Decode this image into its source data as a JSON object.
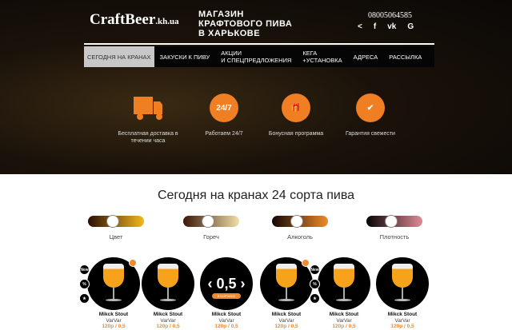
{
  "header": {
    "logo_main": "CraftBeer",
    "logo_suffix": ".kh.ua",
    "tagline": "МАГАЗИН КРАФТОВОГО ПИВА В ХАРЬКОВЕ",
    "phone": "08005064585",
    "social": [
      "<",
      "f",
      "vk",
      "G"
    ]
  },
  "nav": [
    "СЕГОДНЯ НА КРАНАХ",
    "ЗАКУСКИ К ПИВУ",
    "АКЦИИ\nИ СПЕЦПРЕДЛОЖЕНИЯ",
    "КЕГА\n+УСТАНОВКА",
    "АДРЕСА",
    "РАССЫЛКА"
  ],
  "features": [
    {
      "label": "Бесплатная доставка в течении часа",
      "icon": "truck-icon"
    },
    {
      "label": "Работаем 24/7",
      "icon": "24-7-icon",
      "text": "24/7"
    },
    {
      "label": "Бонусная программа",
      "icon": "gift-icon"
    },
    {
      "label": "Гарантия свежести",
      "icon": "check-badge-icon"
    }
  ],
  "title": "Сегодня на кранах 24 сорта пива",
  "filters": [
    {
      "label": "Цвет",
      "value": 0.5,
      "from": "#2a0e05",
      "to": "#f2b81e"
    },
    {
      "label": "Гореч",
      "value": 0.5,
      "from": "#3a1508",
      "to": "#f1dfa8"
    },
    {
      "label": "Алкоголь",
      "value": 0.5,
      "from": "#120605",
      "to": "#f08a28"
    },
    {
      "label": "Плотность",
      "value": 0.5,
      "from": "#050303",
      "to": "#e08a96"
    }
  ],
  "badges": {
    "new": "New",
    "sale": "%",
    "fav": "★"
  },
  "volume": "0,5",
  "cart_label": "В КОРЗИНУ",
  "products": [
    {
      "name": "Mikck Stout",
      "brand": "VarVar",
      "price": "120р / 0,5"
    },
    {
      "name": "Mikck Stout",
      "brand": "VarVar",
      "price": "120р / 0,5"
    },
    {
      "name": "Mikck Stout",
      "brand": "VarVar",
      "price": "120р / 0,5"
    },
    {
      "name": "Mikck Stout",
      "brand": "VarVar",
      "price": "120р / 0,5"
    },
    {
      "name": "Mikck Stout",
      "brand": "VarVar",
      "price": "120р / 0,5"
    },
    {
      "name": "Mikck Stout",
      "brand": "VarVar",
      "price": "120р / 0,5"
    }
  ]
}
